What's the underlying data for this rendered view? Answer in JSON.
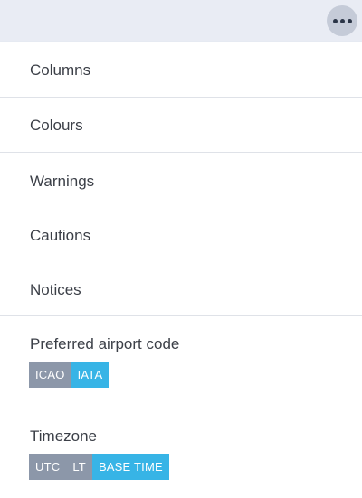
{
  "menu": {
    "items": [
      {
        "label": "Columns"
      },
      {
        "label": "Colours"
      },
      {
        "label": "Warnings"
      },
      {
        "label": "Cautions"
      },
      {
        "label": "Notices"
      }
    ],
    "airport_code": {
      "label": "Preferred airport code",
      "options": [
        {
          "label": "ICAO",
          "selected": false
        },
        {
          "label": "IATA",
          "selected": true
        }
      ]
    },
    "timezone": {
      "label": "Timezone",
      "options": [
        {
          "label": "UTC",
          "selected": false
        },
        {
          "label": "LT",
          "selected": false
        },
        {
          "label": "BASE TIME",
          "selected": true
        }
      ]
    }
  },
  "colors": {
    "selected": "#37b4e6",
    "unselected": "#8c97a9"
  },
  "icons": {
    "more": "more-horizontal-icon"
  }
}
